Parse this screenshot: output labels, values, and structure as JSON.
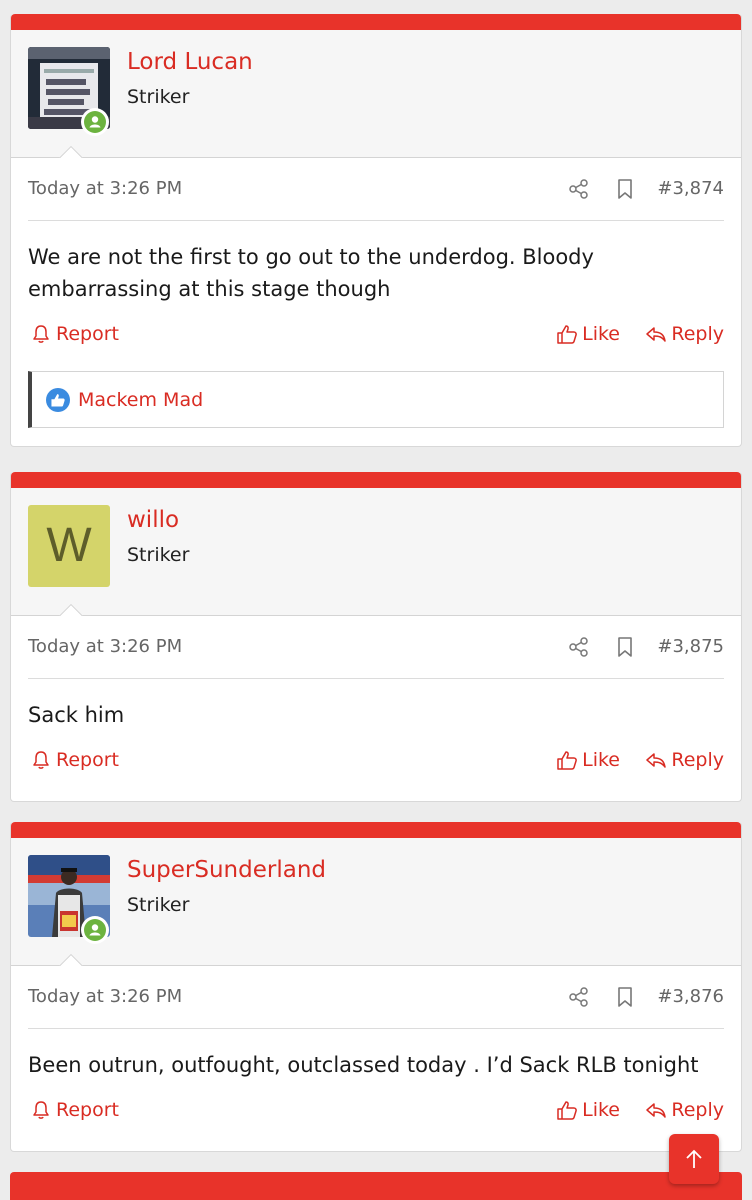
{
  "posts": [
    {
      "user_name": "Lord Lucan",
      "user_title": "Striker",
      "avatar": "newspaper-sign-image",
      "time": "Today at 3:26 PM",
      "number": "#3,874",
      "body": "We are not the first to go out to the underdog. Bloody embarrassing at this stage though",
      "report_label": "Report",
      "like_label": "Like",
      "reply_label": "Reply",
      "reactions": "Mackem Mad"
    },
    {
      "user_name": "willo",
      "user_title": "Striker",
      "avatar_letter": "W",
      "time": "Today at 3:26 PM",
      "number": "#3,875",
      "body": "Sack him",
      "report_label": "Report",
      "like_label": "Like",
      "reply_label": "Reply"
    },
    {
      "user_name": "SuperSunderland",
      "user_title": "Striker",
      "avatar": "person-photo-image",
      "time": "Today at 3:26 PM",
      "number": "#3,876",
      "body": "Been outrun, outfought, outclassed today . I’d Sack RLB tonight",
      "report_label": "Report",
      "like_label": "Like",
      "reply_label": "Reply"
    }
  ],
  "colors": {
    "accent": "#e8332a",
    "link": "#d92c23",
    "online": "#6cb33f",
    "like_badge": "#3a8be0"
  },
  "icons": [
    "share-icon",
    "bookmark-icon",
    "bell-icon",
    "thumbs-up-icon",
    "reply-arrow-icon",
    "arrow-up-icon"
  ]
}
